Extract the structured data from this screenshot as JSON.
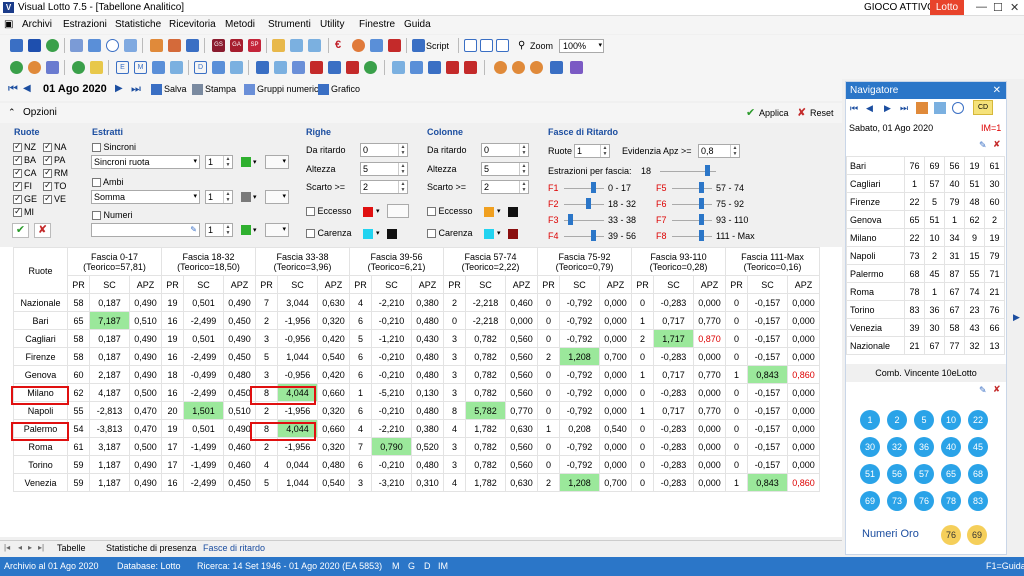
{
  "window": {
    "title": "Visual Lotto 7.5 - [Tabellone Analitico]",
    "gioco_attivo": "GIOCO ATTIVO",
    "lotto_badge": "Lotto",
    "app_icon": "V"
  },
  "menu": [
    "Archivi",
    "Estrazioni",
    "Statistiche",
    "Ricevitoria",
    "Metodi",
    "Strumenti",
    "Utility",
    "Finestre",
    "Guida"
  ],
  "toolbar": {
    "script": "Script",
    "zoom": "Zoom",
    "zoom_value": "100%",
    "gs": "GS",
    "ga": "GA",
    "sp": "SP",
    "euro": "€",
    "e": "E",
    "m": "M",
    "d": "D"
  },
  "navbar": {
    "date": "01 Ago 2020",
    "salva": "Salva",
    "stampa": "Stampa",
    "gruppi": "Gruppi numerici",
    "grafico": "Grafico"
  },
  "options": {
    "label": "Opzioni",
    "applica": "Applica",
    "reset": "Reset",
    "ruote_title": "Ruote",
    "ruote": [
      {
        "name": "NZ",
        "checked": true
      },
      {
        "name": "NA",
        "checked": true
      },
      {
        "name": "BA",
        "checked": true
      },
      {
        "name": "PA",
        "checked": true
      },
      {
        "name": "CA",
        "checked": true
      },
      {
        "name": "RM",
        "checked": true
      },
      {
        "name": "FI",
        "checked": true
      },
      {
        "name": "TO",
        "checked": true
      },
      {
        "name": "GE",
        "checked": true
      },
      {
        "name": "VE",
        "checked": true
      },
      {
        "name": "MI",
        "checked": true
      }
    ],
    "estratti_title": "Estratti",
    "sincroni": "Sincroni",
    "sincroni_ruota": "Sincroni ruota",
    "sincroni_num": "1",
    "ambi": "Ambi",
    "somma": "Somma",
    "somma_num": "1",
    "numeri": "Numeri",
    "numeri_num": "1",
    "righe_title": "Righe",
    "colonne_title": "Colonne",
    "da_ritardo": "Da ritardo",
    "altezza": "Altezza",
    "scarto": "Scarto >=",
    "righe_vals": [
      "0",
      "5",
      "2"
    ],
    "colonne_vals": [
      "0",
      "5",
      "2"
    ],
    "eccesso": "Eccesso",
    "carenza": "Carenza",
    "fasce_title": "Fasce di Ritardo",
    "fasce_ruote": "Ruote",
    "fasce_ruote_val": "1",
    "evidenzia": "Evidenzia Apz >=",
    "evidenzia_val": "0,8",
    "estr_per_fascia": "Estrazioni per fascia:",
    "estr_per_fascia_val": "18",
    "fasce": [
      {
        "code": "F1",
        "range": "0 - 17"
      },
      {
        "code": "F2",
        "range": "18 - 32"
      },
      {
        "code": "F3",
        "range": "33 - 38"
      },
      {
        "code": "F4",
        "range": "39 - 56"
      },
      {
        "code": "F5",
        "range": "57 - 74"
      },
      {
        "code": "F6",
        "range": "75 - 92"
      },
      {
        "code": "F7",
        "range": "93 - 110"
      },
      {
        "code": "F8",
        "range": "111 - Max"
      }
    ]
  },
  "table": {
    "ruote_header": "Ruote",
    "fasce": [
      {
        "l1": "Fascia 0-17",
        "l2": "(Teorico=57,81)"
      },
      {
        "l1": "Fascia 18-32",
        "l2": "(Teorico=18,50)"
      },
      {
        "l1": "Fascia 33-38",
        "l2": "(Teorico=3,96)"
      },
      {
        "l1": "Fascia 39-56",
        "l2": "(Teorico=6,21)"
      },
      {
        "l1": "Fascia 57-74",
        "l2": "(Teorico=2,22)"
      },
      {
        "l1": "Fascia 75-92",
        "l2": "(Teorico=0,79)"
      },
      {
        "l1": "Fascia 93-110",
        "l2": "(Teorico=0,28)"
      },
      {
        "l1": "Fascia 111-Max",
        "l2": "(Teorico=0,16)"
      }
    ],
    "sub": [
      "PR",
      "SC",
      "APZ"
    ],
    "rows": [
      {
        "name": "Nazionale",
        "cells": [
          "58",
          "0,187",
          "0,490",
          "19",
          "0,501",
          "0,490",
          "7",
          "3,044",
          "0,630",
          "4",
          "-2,210",
          "0,380",
          "2",
          "-2,218",
          "0,460",
          "0",
          "-0,792",
          "0,000",
          "0",
          "-0,283",
          "0,000",
          "0",
          "-0,157",
          "0,000"
        ]
      },
      {
        "name": "Bari",
        "cells": [
          "65",
          "7,187",
          "0,510",
          "16",
          "-2,499",
          "0,450",
          "2",
          "-1,956",
          "0,320",
          "6",
          "-0,210",
          "0,480",
          "0",
          "-2,218",
          "0,000",
          "0",
          "-0,792",
          "0,000",
          "1",
          "0,717",
          "0,770",
          "0",
          "-0,157",
          "0,000"
        ]
      },
      {
        "name": "Cagliari",
        "cells": [
          "58",
          "0,187",
          "0,490",
          "19",
          "0,501",
          "0,490",
          "3",
          "-0,956",
          "0,420",
          "5",
          "-1,210",
          "0,430",
          "3",
          "0,782",
          "0,560",
          "0",
          "-0,792",
          "0,000",
          "2",
          "1,717",
          "0,870",
          "0",
          "-0,157",
          "0,000"
        ]
      },
      {
        "name": "Firenze",
        "cells": [
          "58",
          "0,187",
          "0,490",
          "16",
          "-2,499",
          "0,450",
          "5",
          "1,044",
          "0,540",
          "6",
          "-0,210",
          "0,480",
          "3",
          "0,782",
          "0,560",
          "2",
          "1,208",
          "0,700",
          "0",
          "-0,283",
          "0,000",
          "0",
          "-0,157",
          "0,000"
        ]
      },
      {
        "name": "Genova",
        "cells": [
          "60",
          "2,187",
          "0,490",
          "18",
          "-0,499",
          "0,480",
          "3",
          "-0,956",
          "0,420",
          "6",
          "-0,210",
          "0,480",
          "3",
          "0,782",
          "0,560",
          "0",
          "-0,792",
          "0,000",
          "1",
          "0,717",
          "0,770",
          "1",
          "0,843",
          "0,860"
        ]
      },
      {
        "name": "Milano",
        "cells": [
          "62",
          "4,187",
          "0,500",
          "16",
          "-2,499",
          "0,450",
          "8",
          "4,044",
          "0,660",
          "1",
          "-5,210",
          "0,130",
          "3",
          "0,782",
          "0,560",
          "0",
          "-0,792",
          "0,000",
          "0",
          "-0,283",
          "0,000",
          "0",
          "-0,157",
          "0,000"
        ]
      },
      {
        "name": "Napoli",
        "cells": [
          "55",
          "-2,813",
          "0,470",
          "20",
          "1,501",
          "0,510",
          "2",
          "-1,956",
          "0,320",
          "6",
          "-0,210",
          "0,480",
          "8",
          "5,782",
          "0,770",
          "0",
          "-0,792",
          "0,000",
          "1",
          "0,717",
          "0,770",
          "0",
          "-0,157",
          "0,000"
        ]
      },
      {
        "name": "Palermo",
        "cells": [
          "54",
          "-3,813",
          "0,470",
          "19",
          "0,501",
          "0,490",
          "8",
          "4,044",
          "0,660",
          "4",
          "-2,210",
          "0,380",
          "4",
          "1,782",
          "0,630",
          "1",
          "0,208",
          "0,540",
          "0",
          "-0,283",
          "0,000",
          "0",
          "-0,157",
          "0,000"
        ]
      },
      {
        "name": "Roma",
        "cells": [
          "61",
          "3,187",
          "0,500",
          "17",
          "-1,499",
          "0,460",
          "2",
          "-1,956",
          "0,320",
          "7",
          "0,790",
          "0,520",
          "3",
          "0,782",
          "0,560",
          "0",
          "-0,792",
          "0,000",
          "0",
          "-0,283",
          "0,000",
          "0",
          "-0,157",
          "0,000"
        ]
      },
      {
        "name": "Torino",
        "cells": [
          "59",
          "1,187",
          "0,490",
          "17",
          "-1,499",
          "0,460",
          "4",
          "0,044",
          "0,480",
          "6",
          "-0,210",
          "0,480",
          "3",
          "0,782",
          "0,560",
          "0",
          "-0,792",
          "0,000",
          "0",
          "-0,283",
          "0,000",
          "0",
          "-0,157",
          "0,000"
        ]
      },
      {
        "name": "Venezia",
        "cells": [
          "59",
          "1,187",
          "0,490",
          "16",
          "-2,499",
          "0,450",
          "5",
          "1,044",
          "0,540",
          "3",
          "-3,210",
          "0,310",
          "4",
          "1,782",
          "0,630",
          "2",
          "1,208",
          "0,700",
          "0",
          "-0,283",
          "0,000",
          "1",
          "0,843",
          "0,860"
        ]
      }
    ],
    "highlights": {
      "green": [
        [
          1,
          1
        ],
        [
          2,
          19
        ],
        [
          3,
          16
        ],
        [
          4,
          22
        ],
        [
          5,
          7
        ],
        [
          6,
          4
        ],
        [
          6,
          13
        ],
        [
          7,
          7
        ],
        [
          8,
          10
        ],
        [
          10,
          16
        ],
        [
          10,
          22
        ]
      ],
      "red_text": [
        [
          2,
          20
        ],
        [
          4,
          23
        ],
        [
          10,
          23
        ]
      ],
      "green_color": "#9be89b",
      "red_color": "#dd0000"
    },
    "redboxes": [
      "Milano",
      "Palermo"
    ]
  },
  "tabs": [
    "Tabelle",
    "Statistiche di presenza",
    "Fasce di ritardo"
  ],
  "active_tab": "Fasce di ritardo",
  "status": {
    "archivio": "Archivio al 01 Ago 2020",
    "database": "Database: Lotto",
    "ricerca": "Ricerca:  14 Set 1946 - 01 Ago 2020 (EA 5853)",
    "m": "M",
    "g": "G",
    "d": "D",
    "im": "IM",
    "help": "F1=Guida"
  },
  "navigator": {
    "title": "Navigatore",
    "date": "Sabato, 01 Ago 2020",
    "im": "IM=1",
    "cd": "CD",
    "rows": [
      {
        "name": "Bari",
        "nums": [
          "76",
          "69",
          "56",
          "19",
          "61"
        ]
      },
      {
        "name": "Cagliari",
        "nums": [
          "1",
          "57",
          "40",
          "51",
          "30"
        ]
      },
      {
        "name": "Firenze",
        "nums": [
          "22",
          "5",
          "79",
          "48",
          "60"
        ]
      },
      {
        "name": "Genova",
        "nums": [
          "65",
          "51",
          "1",
          "62",
          "2"
        ]
      },
      {
        "name": "Milano",
        "nums": [
          "22",
          "10",
          "34",
          "9",
          "19"
        ]
      },
      {
        "name": "Napoli",
        "nums": [
          "73",
          "2",
          "31",
          "15",
          "79"
        ]
      },
      {
        "name": "Palermo",
        "nums": [
          "68",
          "45",
          "87",
          "55",
          "71"
        ]
      },
      {
        "name": "Roma",
        "nums": [
          "78",
          "1",
          "67",
          "74",
          "21"
        ]
      },
      {
        "name": "Torino",
        "nums": [
          "83",
          "36",
          "67",
          "23",
          "76"
        ]
      },
      {
        "name": "Venezia",
        "nums": [
          "39",
          "30",
          "58",
          "43",
          "66"
        ]
      },
      {
        "name": "Nazionale",
        "nums": [
          "21",
          "67",
          "77",
          "32",
          "13"
        ]
      }
    ],
    "comb_title": "Comb. Vincente 10eLotto",
    "comb": [
      "1",
      "2",
      "5",
      "10",
      "22",
      "30",
      "32",
      "36",
      "40",
      "45",
      "51",
      "56",
      "57",
      "65",
      "68",
      "69",
      "73",
      "76",
      "78",
      "83"
    ],
    "numeri_oro": "Numeri Oro",
    "oro": [
      "76",
      "69"
    ]
  },
  "colors": {
    "accent": "#2b76c8",
    "ball": "#2aa3e8",
    "gold": "#f5cf5a",
    "red": "#e01010"
  }
}
